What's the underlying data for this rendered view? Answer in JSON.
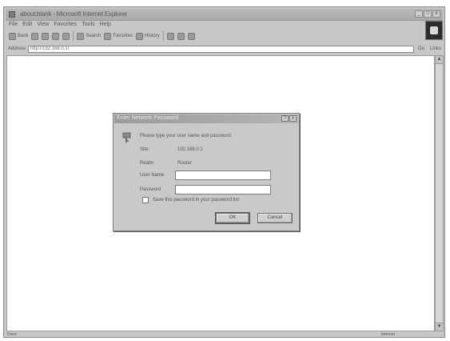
{
  "window": {
    "title": "about:blank - Microsoft Internet Explorer",
    "minimize": "_",
    "maximize": "□",
    "close": "x"
  },
  "menu": [
    "File",
    "Edit",
    "View",
    "Favorites",
    "Tools",
    "Help"
  ],
  "toolbar": {
    "back": "Back",
    "forward": "",
    "stop": "",
    "refresh": "",
    "home": "",
    "search": "Search",
    "favorites": "Favorites",
    "history": "History",
    "mail": "",
    "print": "",
    "edit": ""
  },
  "address": {
    "label": "Address",
    "value": "http://192.168.0.1/",
    "go": "Go",
    "links": "Links"
  },
  "dialog": {
    "title": "Enter Network Password",
    "help": "?",
    "close": "x",
    "prompt": "Please type your user name and password.",
    "site_label": "Site:",
    "site_value": "192.168.0.1",
    "realm_label": "Realm",
    "realm_value": "Router",
    "username_label": "User Name",
    "username_value": "",
    "password_label": "Password",
    "password_value": "",
    "save_password_label": "Save this password in your password list",
    "ok_label": "OK",
    "cancel_label": "Cancel"
  },
  "status": {
    "text": "Done",
    "zone": "Internet"
  }
}
